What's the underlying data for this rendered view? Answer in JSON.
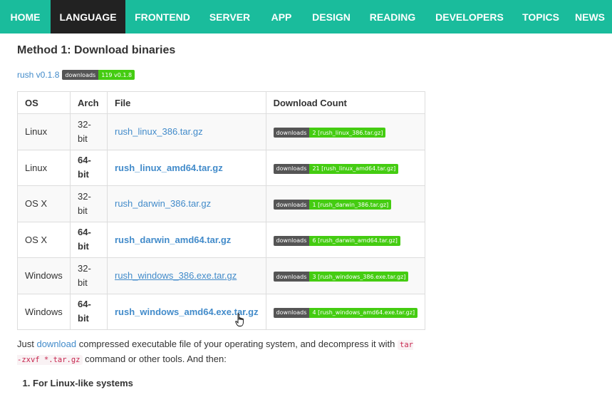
{
  "nav": {
    "items": [
      {
        "label": "HOME"
      },
      {
        "label": "LANGUAGE"
      },
      {
        "label": "FRONTEND"
      },
      {
        "label": "SERVER"
      },
      {
        "label": "APP"
      },
      {
        "label": "DESIGN"
      },
      {
        "label": "READING"
      },
      {
        "label": "DEVELOPERS"
      },
      {
        "label": "TOPICS"
      },
      {
        "label": "NEWS"
      }
    ],
    "active": "LANGUAGE",
    "bg_color": "#1abc9c",
    "active_color": "#222222"
  },
  "content": {
    "heading": "Method 1: Download binaries",
    "version_link": "rush v0.1.8",
    "version_badge": {
      "left": "downloads",
      "right": "119 v0.1.8"
    },
    "table": {
      "headers": [
        "OS",
        "Arch",
        "File",
        "Download Count"
      ],
      "rows": [
        {
          "os": "Linux",
          "arch": "32-bit",
          "file": "rush_linux_386.tar.gz",
          "badge_left": "downloads",
          "badge_right": "2 [rush_linux_386.tar.gz]"
        },
        {
          "os": "Linux",
          "arch": "64-bit",
          "file": "rush_linux_amd64.tar.gz",
          "badge_left": "downloads",
          "badge_right": "21 [rush_linux_amd64.tar.gz]"
        },
        {
          "os": "OS X",
          "arch": "32-bit",
          "file": "rush_darwin_386.tar.gz",
          "badge_left": "downloads",
          "badge_right": "1 [rush_darwin_386.tar.gz]"
        },
        {
          "os": "OS X",
          "arch": "64-bit",
          "file": "rush_darwin_amd64.tar.gz",
          "badge_left": "downloads",
          "badge_right": "6 [rush_darwin_amd64.tar.gz]"
        },
        {
          "os": "Windows",
          "arch": "32-bit",
          "file": "rush_windows_386.exe.tar.gz",
          "badge_left": "downloads",
          "badge_right": "3 [rush_windows_386.exe.tar.gz]"
        },
        {
          "os": "Windows",
          "arch": "64-bit",
          "file": "rush_windows_amd64.exe.tar.gz",
          "badge_left": "downloads",
          "badge_right": "4 [rush_windows_amd64.exe.tar.gz]"
        }
      ]
    },
    "para": {
      "before": "Just ",
      "link": "download",
      "middle": " compressed executable file of your operating system, and decompress it with ",
      "code1": "tar -zxvf *.tar.gz",
      "after": " command or other tools. And then:"
    },
    "steps": [
      "For Linux-like systems"
    ],
    "colors": {
      "link": "#428bca",
      "badge_left": "#555555",
      "badge_right": "#44cc11",
      "code": "#c7254e"
    }
  }
}
